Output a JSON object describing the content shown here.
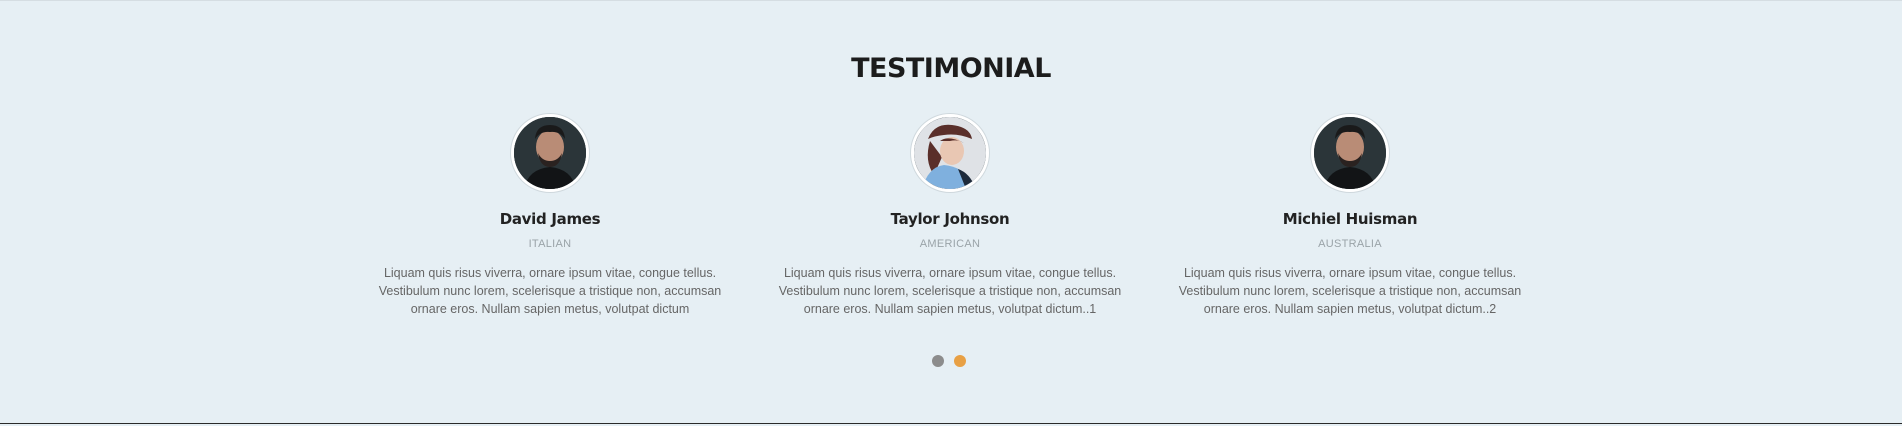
{
  "section": {
    "title": "TESTIMONIAL"
  },
  "testimonials": [
    {
      "name": "David James",
      "origin": "ITALIAN",
      "quote": "Liquam quis risus viverra, ornare ipsum vitae, congue tellus. Vestibulum nunc lorem, scelerisque a tristique non, accumsan ornare eros. Nullam sapien metus, volutpat dictum",
      "avatar": "man-portrait"
    },
    {
      "name": "Taylor Johnson",
      "origin": "AMERICAN",
      "quote": "Liquam quis risus viverra, ornare ipsum vitae, congue tellus. Vestibulum nunc lorem, scelerisque a tristique non, accumsan ornare eros. Nullam sapien metus, volutpat dictum..1",
      "avatar": "woman-portrait"
    },
    {
      "name": "Michiel Huisman",
      "origin": "AUSTRALIA",
      "quote": "Liquam quis risus viverra, ornare ipsum vitae, congue tellus. Vestibulum nunc lorem, scelerisque a tristique non, accumsan ornare eros. Nullam sapien metus, volutpat dictum..2",
      "avatar": "man-portrait"
    }
  ],
  "pagination": {
    "dots": [
      {
        "active": false,
        "color": "#8c8c8c"
      },
      {
        "active": true,
        "color": "#e8a044"
      }
    ]
  },
  "colors": {
    "background": "#e6eff4",
    "title": "#1c1c1c",
    "accent": "#e8a044"
  }
}
